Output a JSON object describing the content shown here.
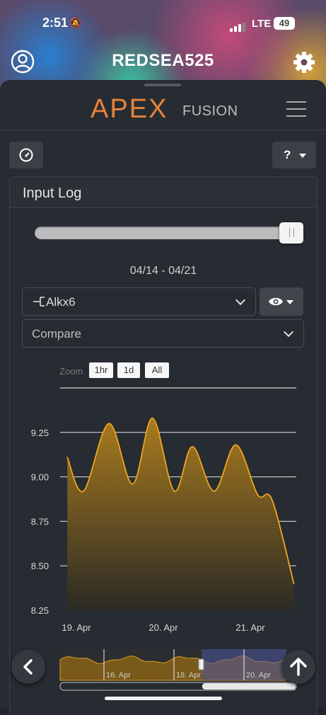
{
  "status_bar": {
    "time": "2:51",
    "network": "LTE",
    "battery": "49"
  },
  "app_bar": {
    "title": "REDSEA525"
  },
  "brand": {
    "logo_main": "APEX",
    "logo_sub": "FUSION"
  },
  "panel": {
    "title": "Input Log",
    "date_range": "04/14 - 04/21",
    "slider_level": 1.0,
    "probe_select": "Alkx6",
    "compare_placeholder": "Compare",
    "zoom": {
      "label": "Zoom",
      "buttons": [
        "1hr",
        "1d",
        "All"
      ]
    }
  },
  "colors": {
    "accent": "#e8823a",
    "series": "#f0a51e",
    "background": "#272c32"
  },
  "icons": {
    "user": "user-circle-icon",
    "settings": "gear-icon",
    "menu": "hamburger-menu-icon",
    "dashboard": "gauge-icon",
    "help": "question-icon",
    "visibility": "eye-icon",
    "back": "chevron-left-icon",
    "scroll_top": "arrow-up-icon"
  },
  "chart_data": [
    {
      "type": "area",
      "series": [
        {
          "values": [
            {
              "x": "18. Apr 21:30",
              "y": 9.11
            },
            {
              "x": "19. Apr 02:00",
              "y": 8.92
            },
            {
              "x": "19. Apr 09:00",
              "y": 9.3
            },
            {
              "x": "19. Apr 15:30",
              "y": 8.96
            },
            {
              "x": "19. Apr 21:00",
              "y": 9.33
            },
            {
              "x": "20. Apr 03:00",
              "y": 8.92
            },
            {
              "x": "20. Apr 08:00",
              "y": 9.17
            },
            {
              "x": "20. Apr 14:00",
              "y": 8.92
            },
            {
              "x": "20. Apr 20:00",
              "y": 9.18
            },
            {
              "x": "21. Apr 02:00",
              "y": 8.9
            },
            {
              "x": "21. Apr 06:00",
              "y": 8.87
            },
            {
              "x": "21. Apr 12:00",
              "y": 8.4
            }
          ]
        }
      ],
      "x_ticks": [
        "19. Apr",
        "20. Apr",
        "21. Apr"
      ],
      "y_ticks": [
        8.25,
        8.5,
        8.75,
        9.0,
        9.25
      ],
      "ylim": [
        8.25,
        9.5
      ],
      "grid": true
    },
    {
      "type": "area",
      "role": "navigator",
      "x_ticks": [
        "16. Apr",
        "18. Apr",
        "20. Apr"
      ],
      "selected_range": [
        "18. Apr",
        "21. Apr"
      ]
    }
  ]
}
